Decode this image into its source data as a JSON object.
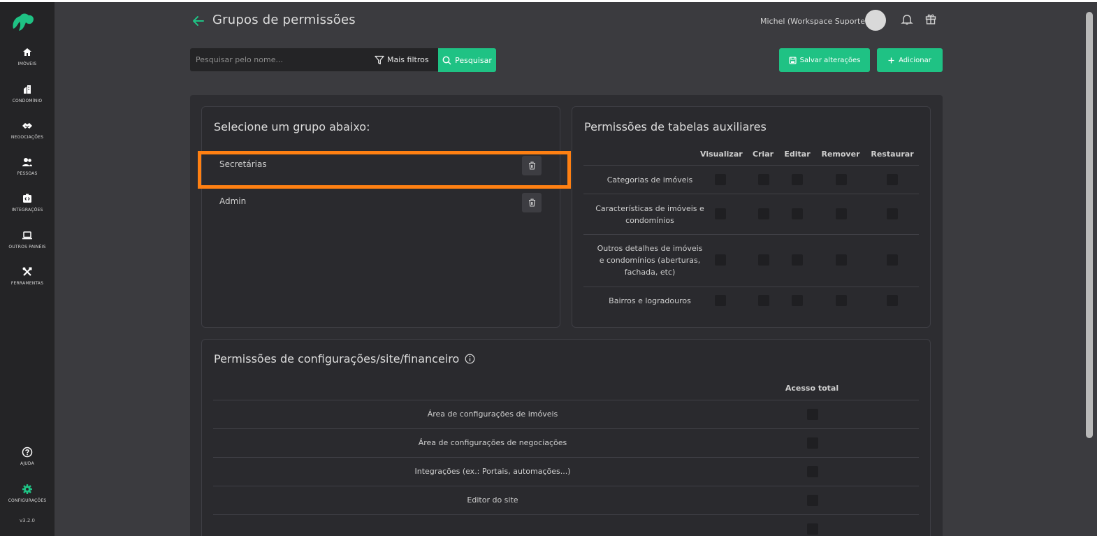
{
  "sidebar": {
    "items": [
      {
        "label": "Imóveis",
        "icon": "home-icon"
      },
      {
        "label": "Condomínio",
        "icon": "building-icon"
      },
      {
        "label": "Negociações",
        "icon": "handshake-icon"
      },
      {
        "label": "Pessoas",
        "icon": "people-icon"
      },
      {
        "label": "Integrações",
        "icon": "integration-icon"
      },
      {
        "label": "Outros painéis",
        "icon": "laptop-icon"
      },
      {
        "label": "Ferramentas",
        "icon": "tools-icon"
      }
    ],
    "help_label": "Ajuda",
    "settings_label": "Configurações",
    "version": "v3.2.0"
  },
  "header": {
    "title": "Grupos de permissões",
    "user": "Michel (Workspace Suporte)"
  },
  "search": {
    "placeholder": "Pesquisar pelo nome...",
    "filters_label": "Mais filtros",
    "search_label": "Pesquisar"
  },
  "actions": {
    "save_label": "Salvar alterações",
    "add_label": "Adicionar"
  },
  "groups": {
    "title": "Selecione um grupo abaixo:",
    "items": [
      {
        "name": "Secretárias",
        "highlighted": true
      },
      {
        "name": "Admin",
        "highlighted": false
      }
    ]
  },
  "aux_permissions": {
    "title": "Permissões de tabelas auxiliares",
    "columns": [
      "Visualizar",
      "Criar",
      "Editar",
      "Remover",
      "Restaurar"
    ],
    "rows": [
      {
        "label": "Categorias de imóveis"
      },
      {
        "label": "Características de imóveis e condomínios"
      },
      {
        "label": "Outros detalhes de imóveis e condomínios (aberturas, fachada, etc)"
      },
      {
        "label": "Bairros e logradouros"
      }
    ]
  },
  "config_permissions": {
    "title": "Permissões de configurações/site/financeiro",
    "column": "Acesso total",
    "rows": [
      {
        "label": "Área de configurações de imóveis"
      },
      {
        "label": "Área de configurações de negociações"
      },
      {
        "label": "Integrações (ex.: Portais, automações...)"
      },
      {
        "label": "Editor do site"
      }
    ]
  },
  "colors": {
    "accent": "#1fc284",
    "highlight": "#ff8012",
    "sidebar_bg": "#242426",
    "page_bg": "#3b3b3f"
  }
}
